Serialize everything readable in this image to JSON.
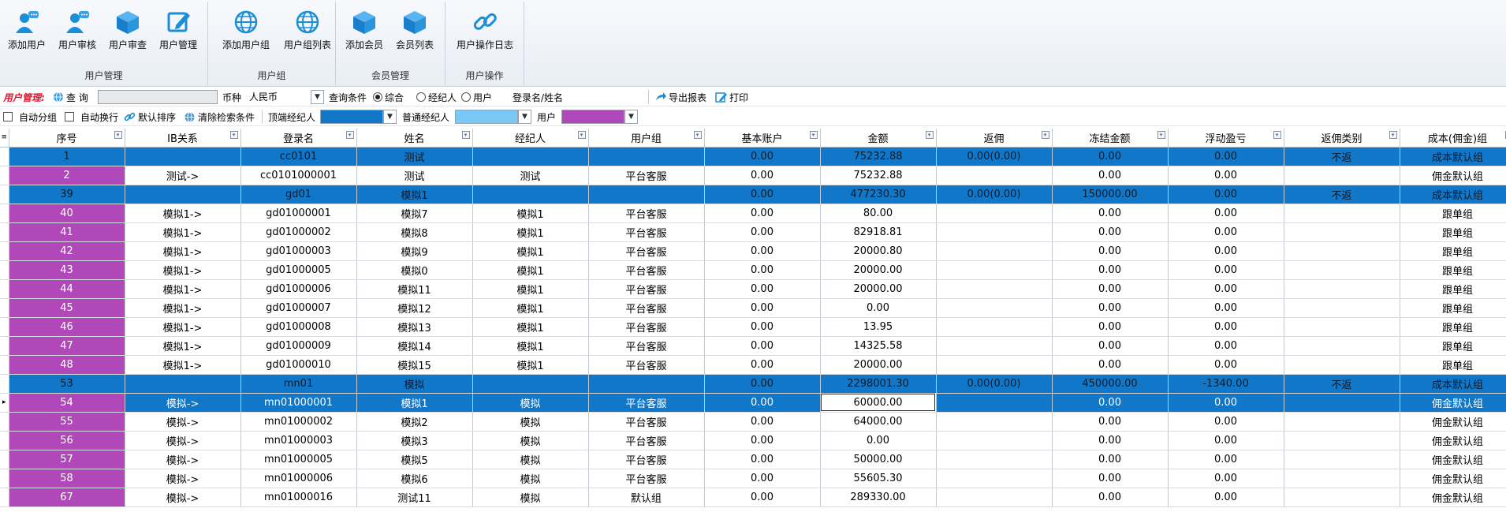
{
  "ribbon": {
    "groups": [
      {
        "name": "用户管理",
        "buttons": [
          {
            "label": "添加用户",
            "icon": "add-user-icon"
          },
          {
            "label": "用户审核",
            "icon": "user-review-icon"
          },
          {
            "label": "用户审查",
            "icon": "user-audit-cube-icon"
          },
          {
            "label": "用户管理",
            "icon": "edit-icon"
          }
        ]
      },
      {
        "name": "用户组",
        "buttons": [
          {
            "label": "添加用户组",
            "icon": "globe-icon"
          },
          {
            "label": "用户组列表",
            "icon": "globe-icon"
          }
        ]
      },
      {
        "name": "会员管理",
        "buttons": [
          {
            "label": "添加会员",
            "icon": "cube-icon"
          },
          {
            "label": "会员列表",
            "icon": "cube-icon"
          }
        ]
      },
      {
        "name": "用户操作",
        "buttons": [
          {
            "label": "用户操作日志",
            "icon": "link-icon"
          }
        ]
      }
    ]
  },
  "toolbar1": {
    "section_label": "用户管理:",
    "query_label": "查 询",
    "query_value": "",
    "currency_label": "币种",
    "currency_value": "人民币",
    "condition_label": "查询条件",
    "cond_all": "综合",
    "cond_broker": "经纪人",
    "cond_user": "用户",
    "login_label": "登录名/姓名",
    "export_label": "导出报表",
    "print_label": "打印"
  },
  "toolbar2": {
    "auto_group": "自动分组",
    "auto_wrap": "自动换行",
    "default_sort": "默认排序",
    "clear_filter": "清除检索条件",
    "top_broker_label": "顶端经纪人",
    "top_broker_color": "#1177c9",
    "normal_broker_label": "普通经纪人",
    "normal_broker_color": "#79c8f5",
    "user_label": "用户",
    "user_color": "#b148b9"
  },
  "table": {
    "columns": [
      "序号",
      "IB关系",
      "登录名",
      "姓名",
      "经纪人",
      "用户组",
      "基本账户",
      "金额",
      "返佣",
      "冻结金额",
      "浮动盈亏",
      "返佣类别",
      "成本(佣金)组"
    ],
    "rows": [
      {
        "type": "top",
        "cells": [
          "1",
          "",
          "cc0101",
          "测试",
          "",
          "",
          "0.00",
          "75232.88",
          "0.00(0.00)",
          "0.00",
          "0.00",
          "不返",
          "成本默认组"
        ]
      },
      {
        "type": "user",
        "cells": [
          "2",
          "测试->",
          "cc0101000001",
          "测试",
          "测试",
          "平台客服",
          "0.00",
          "75232.88",
          "",
          "0.00",
          "0.00",
          "",
          "佣金默认组"
        ]
      },
      {
        "type": "top",
        "cells": [
          "39",
          "",
          "gd01",
          "模拟1",
          "",
          "",
          "0.00",
          "477230.30",
          "0.00(0.00)",
          "150000.00",
          "0.00",
          "不返",
          "成本默认组"
        ]
      },
      {
        "type": "user",
        "cells": [
          "40",
          "模拟1->",
          "gd01000001",
          "模拟7",
          "模拟1",
          "平台客服",
          "0.00",
          "80.00",
          "",
          "0.00",
          "0.00",
          "",
          "跟单组"
        ]
      },
      {
        "type": "user",
        "cells": [
          "41",
          "模拟1->",
          "gd01000002",
          "模拟8",
          "模拟1",
          "平台客服",
          "0.00",
          "82918.81",
          "",
          "0.00",
          "0.00",
          "",
          "跟单组"
        ]
      },
      {
        "type": "user",
        "cells": [
          "42",
          "模拟1->",
          "gd01000003",
          "模拟9",
          "模拟1",
          "平台客服",
          "0.00",
          "20000.80",
          "",
          "0.00",
          "0.00",
          "",
          "跟单组"
        ]
      },
      {
        "type": "user",
        "cells": [
          "43",
          "模拟1->",
          "gd01000005",
          "模拟0",
          "模拟1",
          "平台客服",
          "0.00",
          "20000.00",
          "",
          "0.00",
          "0.00",
          "",
          "跟单组"
        ]
      },
      {
        "type": "user",
        "cells": [
          "44",
          "模拟1->",
          "gd01000006",
          "模拟11",
          "模拟1",
          "平台客服",
          "0.00",
          "20000.00",
          "",
          "0.00",
          "0.00",
          "",
          "跟单组"
        ]
      },
      {
        "type": "user",
        "cells": [
          "45",
          "模拟1->",
          "gd01000007",
          "模拟12",
          "模拟1",
          "平台客服",
          "0.00",
          "0.00",
          "",
          "0.00",
          "0.00",
          "",
          "跟单组"
        ]
      },
      {
        "type": "user",
        "cells": [
          "46",
          "模拟1->",
          "gd01000008",
          "模拟13",
          "模拟1",
          "平台客服",
          "0.00",
          "13.95",
          "",
          "0.00",
          "0.00",
          "",
          "跟单组"
        ]
      },
      {
        "type": "user",
        "cells": [
          "47",
          "模拟1->",
          "gd01000009",
          "模拟14",
          "模拟1",
          "平台客服",
          "0.00",
          "14325.58",
          "",
          "0.00",
          "0.00",
          "",
          "跟单组"
        ]
      },
      {
        "type": "user",
        "cells": [
          "48",
          "模拟1->",
          "gd01000010",
          "模拟15",
          "模拟1",
          "平台客服",
          "0.00",
          "20000.00",
          "",
          "0.00",
          "0.00",
          "",
          "跟单组"
        ]
      },
      {
        "type": "top",
        "cells": [
          "53",
          "",
          "mn01",
          "模拟",
          "",
          "",
          "0.00",
          "2298001.30",
          "0.00(0.00)",
          "450000.00",
          "-1340.00",
          "不返",
          "成本默认组"
        ]
      },
      {
        "type": "selected",
        "cells": [
          "54",
          "模拟->",
          "mn01000001",
          "模拟1",
          "模拟",
          "平台客服",
          "0.00",
          "60000.00",
          "",
          "0.00",
          "0.00",
          "",
          "佣金默认组"
        ]
      },
      {
        "type": "user",
        "cells": [
          "55",
          "模拟->",
          "mn01000002",
          "模拟2",
          "模拟",
          "平台客服",
          "0.00",
          "64000.00",
          "",
          "0.00",
          "0.00",
          "",
          "佣金默认组"
        ]
      },
      {
        "type": "user",
        "cells": [
          "56",
          "模拟->",
          "mn01000003",
          "模拟3",
          "模拟",
          "平台客服",
          "0.00",
          "0.00",
          "",
          "0.00",
          "0.00",
          "",
          "佣金默认组"
        ]
      },
      {
        "type": "user",
        "cells": [
          "57",
          "模拟->",
          "mn01000005",
          "模拟5",
          "模拟",
          "平台客服",
          "0.00",
          "50000.00",
          "",
          "0.00",
          "0.00",
          "",
          "佣金默认组"
        ]
      },
      {
        "type": "user",
        "cells": [
          "58",
          "模拟->",
          "mn01000006",
          "模拟6",
          "模拟",
          "平台客服",
          "0.00",
          "55605.30",
          "",
          "0.00",
          "0.00",
          "",
          "佣金默认组"
        ]
      },
      {
        "type": "user",
        "cells": [
          "67",
          "模拟->",
          "mn01000016",
          "测试11",
          "模拟",
          "默认组",
          "0.00",
          "289330.00",
          "",
          "0.00",
          "0.00",
          "",
          "佣金默认组"
        ]
      }
    ]
  }
}
